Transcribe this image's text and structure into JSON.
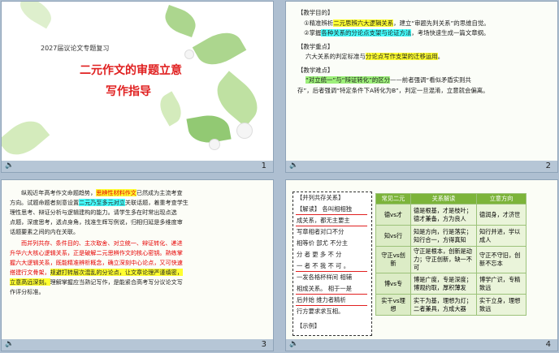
{
  "slides": [
    {
      "number": "1",
      "subtitle": "2027届议论文专题复习",
      "title_line1": "二元作文的审题立意",
      "title_line2": "写作指导"
    },
    {
      "number": "2",
      "sections": {
        "goal_head": "【教学目的】",
        "goal_1a": "①精准辨析",
        "goal_1b": "二元思辨六大逻辑关系",
        "goal_1c": "，建立“审题先判关系”的思维自觉。",
        "goal_2a": "②掌握",
        "goal_2b": "各种关系的分论点支架与论证方法",
        "goal_2c": "，考场快速生成一篇文章纲。",
        "key_head": "【教学重点】",
        "key_1a": "六大关系的判定标准与",
        "key_1b": "分论点写作支架的迁移运用",
        "key_1c": "。",
        "diff_head": "【教学难点】",
        "diff_1a": "“对立统一”与“辩证转化”的区分",
        "diff_1b": "——前者强调“看似矛盾实则共",
        "diff_2": "存”，后者强调“特定条件下A转化为B”，判定一旦混淆，立意就会偏离。"
      }
    },
    {
      "number": "3",
      "p1_1": "纵观近年高考作文命题趋势，",
      "p1_1hl": "思辨性材料作文",
      "p1_1b": "已然成为主流考查",
      "p1_2a": "方向。试题命题者刻意设置",
      "p1_2hl": "二元乃至多元对立",
      "p1_2b": "关联话题，着重考查学生",
      "p1_3": "理性思考、辩证分析与逻辑建构的能力。请学生多在时常出现点选",
      "p1_4": "点题，深度思考，透点身角，找准生辉写例说，归相归延是多维度审",
      "p1_5": "话题要素之间的内在关联。",
      "p2_1": "而并列共存、条件目的、主次取舍、对立统一、辩证转化、递进",
      "p2_2": "升华六大核心逻辑关系，正是破解二元思辨作文的核心密钥。熟练掌",
      "p2_3": "握六大逻辑关系，既能精准辨析概念，确立深刻中心论点，又可快速",
      "p2_4a": "搭建行文骨架，",
      "p2_4b": "规避打转层次混乱的分论点，让文章论理严谨缜密，",
      "p2_5a": "立意高远深刻。",
      "p2_5b": "理解掌握应当熟记写作，是能紧合高考写分议论文写",
      "p2_6": "作评分标准。"
    },
    {
      "number": "4",
      "box_title": "【并列共存关系】",
      "box_lines": [
        "【解读】 各叫相相独",
        "成关系，都无主要主",
        "写章相者对口不分",
        "相等价  部尤  不分主",
        "分  者  更  多  不  分",
        "一  者  不  我  不  可  。",
        "一发各格杯样间  相辅",
        "相成关系。   相于一是",
        "后并始  维力者精析",
        "行方要求求互相。"
      ],
      "box_example": "【示例】",
      "table": {
        "headers": [
          "常见二元",
          "关系解读",
          "立意方向"
        ],
        "rows": [
          [
            "德vs才",
            "德是根基，才是枝叶；德才兼备，方为良人",
            "德润身，才济世"
          ],
          [
            "知vs行",
            "知是方向，行是落实；知行合一，方得真知",
            "知行并进，学以成人"
          ],
          [
            "守正vs创新",
            "守正是根本，创新是动力；守正创新，缺一不可",
            "守正不守旧，创新不忘本"
          ],
          [
            "博vs专",
            "博是广度，专是深度；博观约取，厚积薄发",
            "博学广识，专精致远"
          ],
          [
            "实干vs理想",
            "实干为基，理想为灯；二者兼具，方成大器",
            "实干立身，理想致远"
          ]
        ]
      }
    }
  ],
  "colors": {
    "title_red": "#e02020",
    "highlight_yellow": "#ffff30",
    "highlight_green": "#9df07a",
    "table_header": "#7cb43a"
  },
  "icons": {
    "sound": "speaker-icon"
  }
}
